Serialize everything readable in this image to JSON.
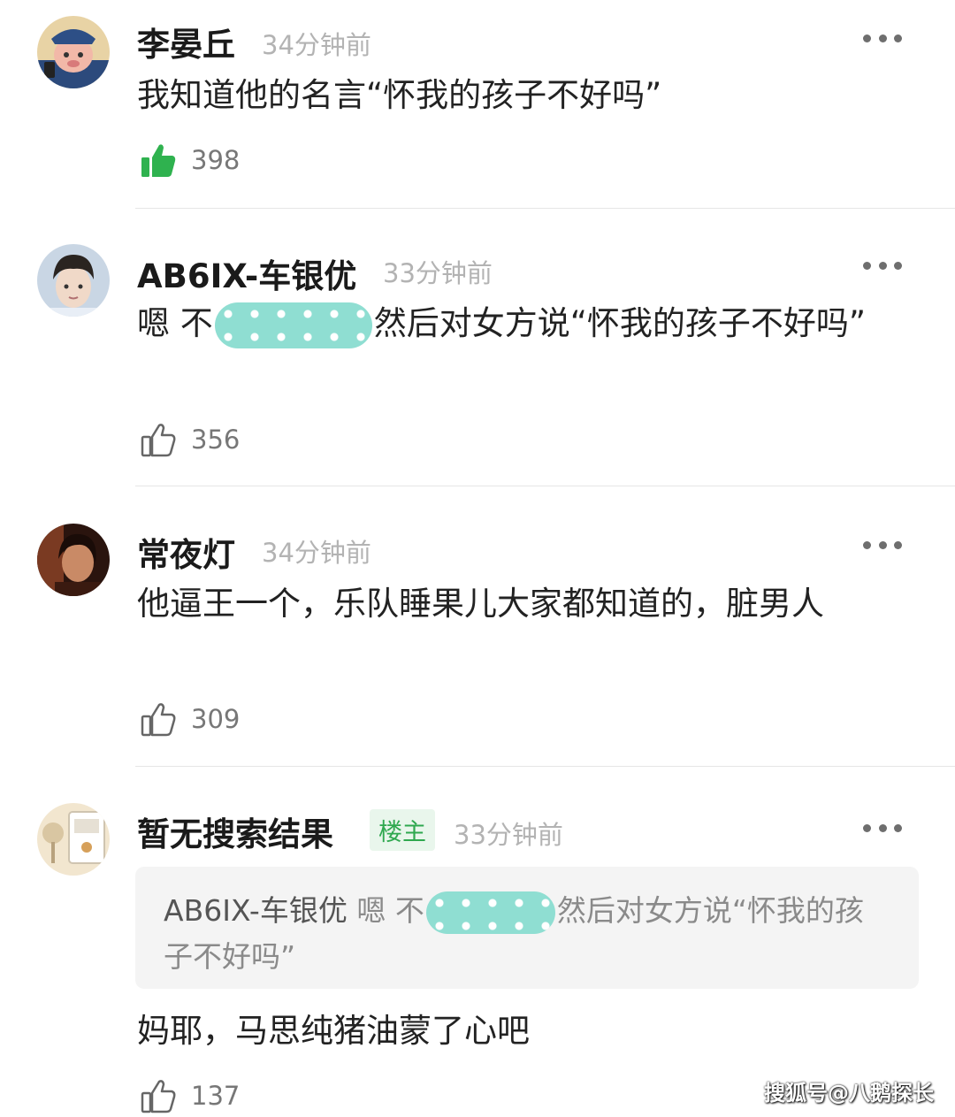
{
  "comments": [
    {
      "name": "李晏丘",
      "time": "34分钟前",
      "text": "我知道他的名言“怀我的孩子不好吗”",
      "likes": "398",
      "liked": true
    },
    {
      "name": "AB6IX-车银优",
      "time": "33分钟前",
      "text_before": "嗯 不",
      "text_after": "然后对女方说“怀我的孩子不好吗”",
      "likes": "356",
      "liked": false
    },
    {
      "name": "常夜灯",
      "time": "34分钟前",
      "text": "他逼王一个，乐队睡果儿大家都知道的，脏男人",
      "likes": "309",
      "liked": false
    },
    {
      "name": "暂无搜索结果",
      "badge": "楼主",
      "time": "33分钟前",
      "quote": {
        "name": "AB6IX-车银优",
        "text_before": "嗯 不",
        "text_after": "然后对女方说“怀我的孩子不好吗”"
      },
      "text": "妈耶，马思纯猪油蒙了心吧",
      "likes": "137",
      "liked": false
    }
  ],
  "watermark": "搜狐号@八鹅探长",
  "colors": {
    "liked_green": "#2fb24f",
    "blur_teal": "#8fded2",
    "badge_green": "#2fa84f"
  }
}
